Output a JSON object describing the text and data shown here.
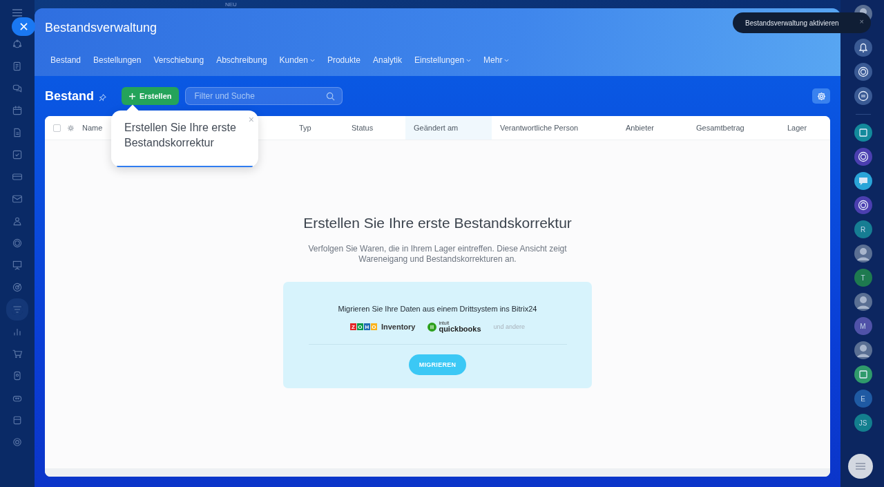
{
  "top": {
    "new_badge": "NEU"
  },
  "toast": {
    "text": "Bestandsverwaltung aktivieren",
    "close": "×"
  },
  "header": {
    "title": "Bestandsverwaltung",
    "tabs": [
      {
        "label": "Bestand",
        "dropdown": false
      },
      {
        "label": "Bestellungen",
        "dropdown": false
      },
      {
        "label": "Verschiebung",
        "dropdown": false
      },
      {
        "label": "Abschreibung",
        "dropdown": false
      },
      {
        "label": "Kunden",
        "dropdown": true
      },
      {
        "label": "Produkte",
        "dropdown": false
      },
      {
        "label": "Analytik",
        "dropdown": false
      },
      {
        "label": "Einstellungen",
        "dropdown": true
      },
      {
        "label": "Mehr",
        "dropdown": true
      }
    ]
  },
  "toolbar": {
    "title": "Bestand",
    "create_button": "Erstellen",
    "search": {
      "placeholder": "Filter und Suche"
    }
  },
  "table": {
    "select_all_checked": false,
    "columns": [
      {
        "label": "Name",
        "sorted": false
      },
      {
        "label": "Typ",
        "sorted": false
      },
      {
        "label": "Status",
        "sorted": false
      },
      {
        "label": "Geändert am",
        "sorted": true
      },
      {
        "label": "Verantwortliche Person",
        "sorted": false
      },
      {
        "label": "Anbieter",
        "sorted": false
      },
      {
        "label": "Gesamtbetrag",
        "sorted": false
      },
      {
        "label": "Lager",
        "sorted": false
      }
    ]
  },
  "hint": {
    "text": "Erstellen Sie Ihre erste Bestandskorrektur",
    "close": "×"
  },
  "empty": {
    "title": "Erstellen Sie Ihre erste Bestandskorrektur",
    "description": "Verfolgen Sie Waren, die in Ihrem Lager eintreffen. Diese Ansicht zeigt Wareneigang und Bestandskorrekturen an.",
    "migrate": {
      "text": "Migrieren Sie Ihre Daten aus einem Drittsystem ins Bitrix24",
      "zoho": {
        "letters": [
          {
            "text": "Z",
            "color": "#e42527"
          },
          {
            "text": "O",
            "color": "#089949"
          },
          {
            "text": "H",
            "color": "#226db4"
          },
          {
            "text": "O",
            "color": "#f9b21d"
          }
        ],
        "label": "Inventory"
      },
      "quickbooks": {
        "brand": "intuit",
        "label": "quickbooks"
      },
      "others": "und andere",
      "button": "MIGRIEREN"
    }
  },
  "right_bar": {
    "items": [
      {
        "kind": "avatar"
      },
      {
        "kind": "bell"
      },
      {
        "kind": "ring"
      },
      {
        "kind": "swap"
      },
      {
        "kind": "divider"
      },
      {
        "kind": "app",
        "color": "#138a9c"
      },
      {
        "kind": "ring",
        "color": "#4b3fb0"
      },
      {
        "kind": "chat",
        "color": "#2aa4d8"
      },
      {
        "kind": "ring",
        "color": "#4b3fb0"
      },
      {
        "kind": "letter",
        "text": "R",
        "color": "#167d93"
      },
      {
        "kind": "avatar"
      },
      {
        "kind": "letter",
        "text": "T",
        "color": "#1e7a4f"
      },
      {
        "kind": "avatar"
      },
      {
        "kind": "letter",
        "text": "M",
        "color": "#4f52a8"
      },
      {
        "kind": "avatar"
      },
      {
        "kind": "app",
        "color": "#2f9a6b"
      },
      {
        "kind": "letter",
        "text": "E",
        "color": "#1f5aa3"
      },
      {
        "kind": "letter",
        "text": "JS",
        "color": "#137f8e"
      }
    ]
  }
}
